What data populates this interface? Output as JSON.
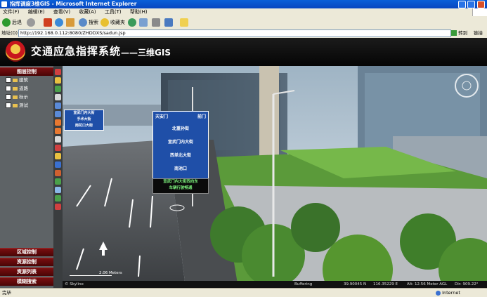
{
  "window": {
    "title": "指挥调度3维GIS - Microsoft Internet Explorer"
  },
  "menu": [
    "文件(F)",
    "编辑(E)",
    "查看(V)",
    "收藏(A)",
    "工具(T)",
    "帮助(H)"
  ],
  "toolbar": {
    "back": "后退",
    "search": "搜索",
    "favorites": "收藏夹"
  },
  "address": {
    "label": "地址(D)",
    "url": "http://192.168.0.112:8080/ZHDDXS/sadun.jsp",
    "go": "转到",
    "links": "链接"
  },
  "banner": {
    "title": "交通应急指挥系统",
    "subtitle": "——三维GIS"
  },
  "panel": {
    "layer_header": "图层控制",
    "layers": [
      "建筑",
      "道路",
      "标示",
      "测试"
    ],
    "bottom": [
      "区域控制",
      "资源控制",
      "资源列表",
      "模糊搜索"
    ]
  },
  "view": {
    "sign_main": [
      "天安门",
      "前门",
      "北重孙街",
      "宣武门内大街",
      "西单北大街",
      "南池口"
    ],
    "sign_bottom": [
      "宣武门内大街西向东",
      "车辆行驶畅通"
    ],
    "sign_small": [
      "宣武门内大街",
      "手术大街",
      "雨花口大街"
    ],
    "scale": "2.06 Meters",
    "brand": "© Skyline",
    "status_buffering": "Buffering",
    "status_lat": "39.90045 N",
    "status_lon": "116.35229 E",
    "status_alt": "Alt: 12.56 Meter AGL",
    "status_dir": "Dir: 909.22°"
  },
  "ie_status": {
    "left": "完毕",
    "right": "Internet"
  },
  "colors": {
    "titlebar": "#0A5FD8",
    "banner": "#050505",
    "panel_header": "#7A0E10",
    "sign_blue": "#1F4FA8"
  }
}
